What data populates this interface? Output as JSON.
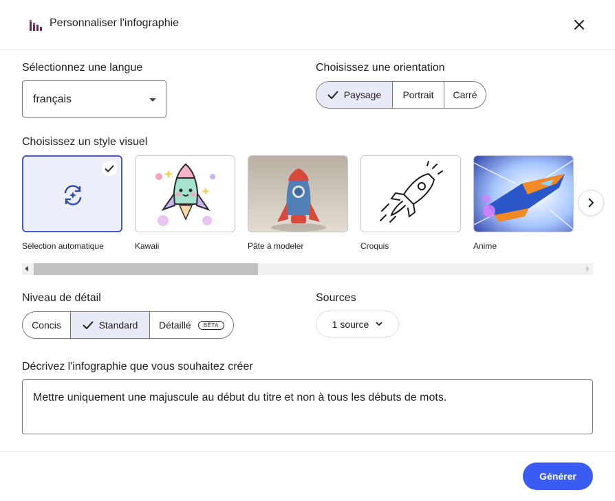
{
  "header": {
    "title": "Personnaliser l'infographie",
    "icon": "infographic-icon"
  },
  "language": {
    "label": "Sélectionnez une langue",
    "value": "français"
  },
  "orientation": {
    "label": "Choisissez une orientation",
    "options": [
      "Paysage",
      "Portrait",
      "Carré"
    ],
    "selected": "Paysage"
  },
  "style": {
    "label": "Choisissez un style visuel",
    "cards": [
      {
        "label": "Sélection automatique",
        "selected": true
      },
      {
        "label": "Kawaii"
      },
      {
        "label": "Pâte à modeler"
      },
      {
        "label": "Croquis"
      },
      {
        "label": "Anime"
      }
    ]
  },
  "detail": {
    "label": "Niveau de détail",
    "options": [
      "Concis",
      "Standard",
      "Détaillé"
    ],
    "selected": "Standard",
    "beta_badge": "BÊTA"
  },
  "sources": {
    "label": "Sources",
    "button": "1 source"
  },
  "description": {
    "label": "Décrivez l'infographie que vous souhaitez créer",
    "value": "Mettre uniquement une majuscule au début du titre et non à tous les débuts de mots."
  },
  "footer": {
    "generate": "Générer"
  },
  "colors": {
    "accent": "#3b5cf3",
    "selected_bg": "#e8eaf6",
    "selected_border": "#4a5bbf"
  }
}
